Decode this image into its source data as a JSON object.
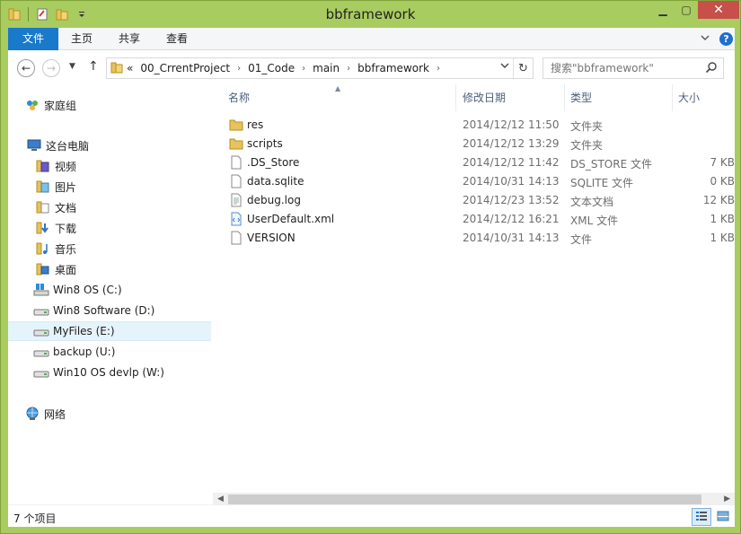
{
  "window": {
    "title": "bbframework"
  },
  "ribbon": {
    "tabs": [
      "文件",
      "主页",
      "共享",
      "查看"
    ]
  },
  "address": {
    "overflow": "«",
    "crumbs": [
      "00_CrrentProject",
      "01_Code",
      "main",
      "bbframework"
    ],
    "search_placeholder": "搜索\"bbframework\""
  },
  "nav": {
    "homegroup": "家庭组",
    "thispc": "这台电脑",
    "folders": [
      "视频",
      "图片",
      "文档",
      "下载",
      "音乐",
      "桌面"
    ],
    "drives": [
      "Win8 OS (C:)",
      "Win8 Software (D:)",
      "MyFiles (E:)",
      "backup (U:)",
      "Win10 OS devlp (W:)"
    ],
    "network": "网络"
  },
  "columns": {
    "name": "名称",
    "date": "修改日期",
    "type": "类型",
    "size": "大小"
  },
  "files": [
    {
      "name": "res",
      "date": "2014/12/12 11:50",
      "type": "文件夹",
      "size": "",
      "icon": "folder-icon"
    },
    {
      "name": "scripts",
      "date": "2014/12/12 13:29",
      "type": "文件夹",
      "size": "",
      "icon": "folder-icon"
    },
    {
      "name": ".DS_Store",
      "date": "2014/12/12 11:42",
      "type": "DS_STORE 文件",
      "size": "7 KB",
      "icon": "file-icon"
    },
    {
      "name": "data.sqlite",
      "date": "2014/10/31 14:13",
      "type": "SQLITE 文件",
      "size": "0 KB",
      "icon": "file-icon"
    },
    {
      "name": "debug.log",
      "date": "2014/12/23 13:52",
      "type": "文本文档",
      "size": "12 KB",
      "icon": "text-file-icon"
    },
    {
      "name": "UserDefault.xml",
      "date": "2014/12/12 16:21",
      "type": "XML 文件",
      "size": "1 KB",
      "icon": "xml-file-icon"
    },
    {
      "name": "VERSION",
      "date": "2014/10/31 14:13",
      "type": "文件",
      "size": "1 KB",
      "icon": "file-icon"
    }
  ],
  "status": {
    "count": "7 个项目"
  },
  "colors": {
    "frame": "#a8cc5f",
    "file_tab": "#1979ca",
    "close": "#c7504b",
    "selected": "#e5f3fb",
    "folder": "#e8c25a"
  }
}
